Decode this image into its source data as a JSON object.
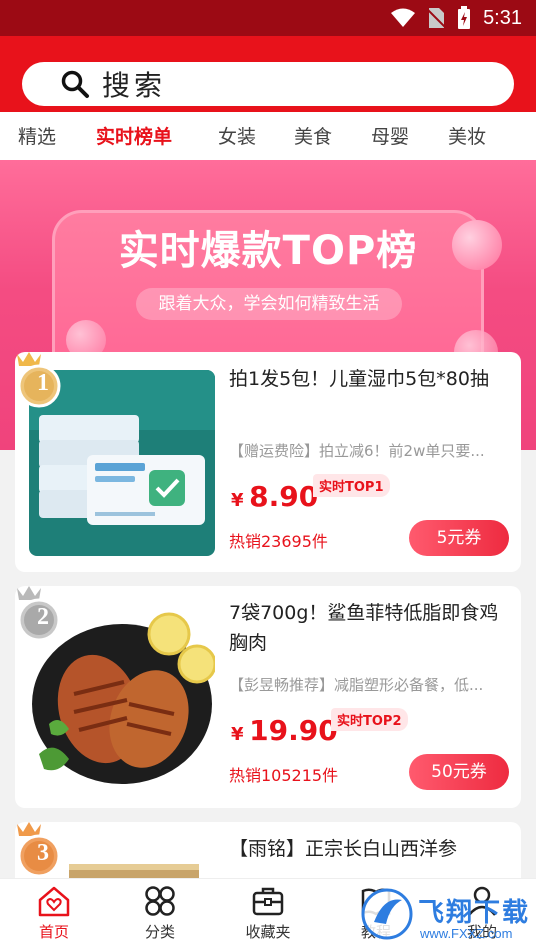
{
  "status_bar": {
    "time": "5:31"
  },
  "search": {
    "placeholder": "搜索"
  },
  "tabs": [
    {
      "label": "精选",
      "active": false
    },
    {
      "label": "实时榜单",
      "active": true
    },
    {
      "label": "女装",
      "active": false
    },
    {
      "label": "美食",
      "active": false
    },
    {
      "label": "母婴",
      "active": false
    },
    {
      "label": "美妆",
      "active": false
    }
  ],
  "banner": {
    "title": "实时爆款TOP榜",
    "subtitle": "跟着大众，学会如何精致生活"
  },
  "products": [
    {
      "rank": "1",
      "title": "拍1发5包！儿童湿巾5包*80抽",
      "desc": "【赠运费险】拍立减6！前2w单只要...",
      "currency": "¥",
      "price": "8.90",
      "tag": "实时TOP1",
      "sold": "热销23695件",
      "coupon": "5元券"
    },
    {
      "rank": "2",
      "title": "7袋700g！鲨鱼菲特低脂即食鸡胸肉",
      "desc": "【彭昱畅推荐】减脂塑形必备餐，低...",
      "currency": "¥",
      "price": "19.90",
      "tag": "实时TOP2",
      "sold": "热销105215件",
      "coupon": "50元券"
    },
    {
      "rank": "3",
      "title": "【雨铭】正宗长白山西洋参"
    }
  ],
  "bottom_nav": [
    {
      "label": "首页",
      "icon": "home-heart-icon",
      "active": true
    },
    {
      "label": "分类",
      "icon": "grid-icon",
      "active": false
    },
    {
      "label": "收藏夹",
      "icon": "briefcase-icon",
      "active": false
    },
    {
      "label": "教程",
      "icon": "book-icon",
      "active": false
    },
    {
      "label": "我的",
      "icon": "user-icon",
      "active": false
    }
  ],
  "watermark": {
    "text": "飞翔下载",
    "sub": "www.FXXZ.com"
  },
  "colors": {
    "brand_red": "#e8121b",
    "status_bar": "#9c0a14",
    "banner_pink": "#f44c82"
  }
}
